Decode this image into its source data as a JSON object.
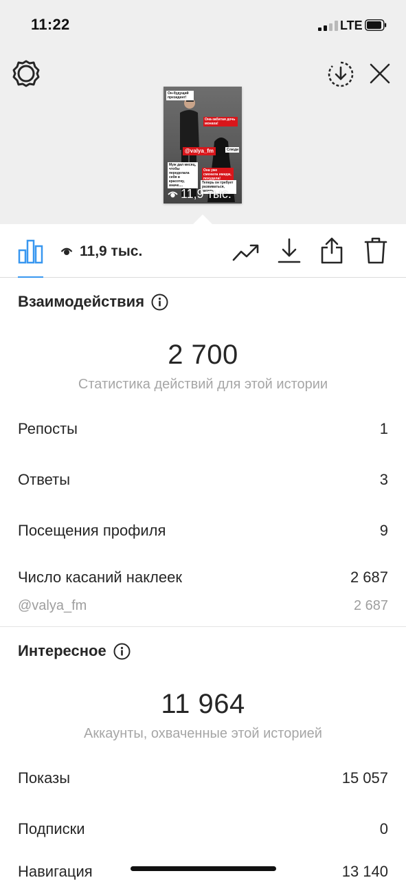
{
  "status_bar": {
    "time": "11:22",
    "network": "LTE"
  },
  "top": {
    "icons": [
      "gear-icon",
      "download-circle-icon",
      "close-icon"
    ]
  },
  "story_thumbnail": {
    "caption_1": "Он-будущий президент!",
    "caption_2": "Она-забитая дочь монаха!",
    "mention": "@valya_fm",
    "caption_3": "Слюди",
    "caption_4": "Муж дал месяц, чтобы переделала себя в красотку, иначе....",
    "caption_5": "Она уже сменила имидж, похудела!",
    "caption_6": "Теперь он требует развиваться, читать",
    "views": "11,9 тыс."
  },
  "toolbar": {
    "views_label": "11,9 тыс.",
    "icons": [
      "insights-bar-chart-icon",
      "eye-icon",
      "trend-up-icon",
      "download-icon",
      "share-icon",
      "trash-icon"
    ],
    "accent_color": "#3897f0"
  },
  "interactions": {
    "title": "Взаимодействия",
    "total": "2 700",
    "caption": "Статистика действий для этой истории",
    "rows": [
      {
        "label": "Репосты",
        "value": "1"
      },
      {
        "label": "Ответы",
        "value": "3"
      },
      {
        "label": "Посещения профиля",
        "value": "9"
      },
      {
        "label": "Число касаний наклеек",
        "value": "2 687"
      }
    ],
    "sticker_sub": {
      "label": "@valya_fm",
      "value": "2 687"
    }
  },
  "discovery": {
    "title": "Интересное",
    "total": "11 964",
    "caption": "Аккаунты, охваченные этой историей",
    "rows": [
      {
        "label": "Показы",
        "value": "15 057"
      },
      {
        "label": "Подписки",
        "value": "0"
      },
      {
        "label": "Навигация",
        "value": "13 140"
      }
    ]
  }
}
